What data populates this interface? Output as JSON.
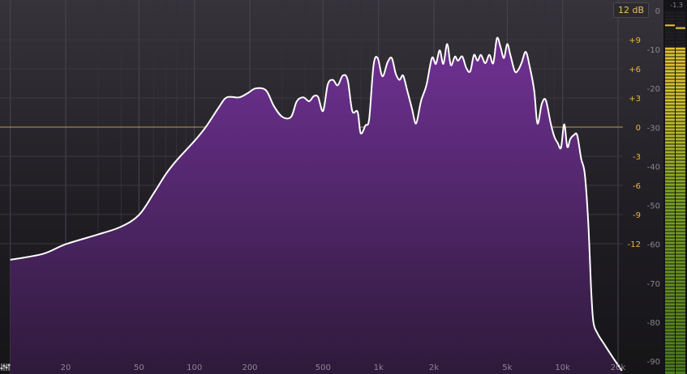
{
  "range_button": {
    "label": "12 dB"
  },
  "freq_labels": [
    "20",
    "50",
    "100",
    "200",
    "500",
    "1k",
    "2k",
    "5k",
    "10k",
    "20k"
  ],
  "freq_values": [
    20,
    50,
    100,
    200,
    500,
    1000,
    2000,
    5000,
    10000,
    20000
  ],
  "eq_scale": {
    "labels": [
      "+9",
      "+6",
      "+3",
      "0",
      "-3",
      "-6",
      "-9",
      "-12"
    ],
    "values": [
      9,
      6,
      3,
      0,
      -3,
      -6,
      -9,
      -12
    ],
    "color": "#e8b93a"
  },
  "db_scale": {
    "labels": [
      "0",
      "-10",
      "-20",
      "-30",
      "-40",
      "-50",
      "-60",
      "-70",
      "-80",
      "-90"
    ],
    "values": [
      0,
      -10,
      -20,
      -30,
      -40,
      -50,
      -60,
      -70,
      -80,
      -90
    ],
    "color": "#8a8690"
  },
  "meter": {
    "peak_label": "-1.3",
    "left_level_db": -9.5,
    "right_level_db": -9.5,
    "left_peak_db": -3.6,
    "right_peak_db": -4.3
  },
  "colors": {
    "spectrum_fill_top": "#6a2f8c",
    "spectrum_fill_bottom": "#2e1a3a",
    "spectrum_line": "#ffffff",
    "zero_line": "#b89a5a",
    "grid": "#3a3640"
  },
  "spectrum": [
    [
      10,
      -64
    ],
    [
      15,
      -62.5
    ],
    [
      20,
      -60
    ],
    [
      30,
      -57.5
    ],
    [
      40,
      -55.5
    ],
    [
      50,
      -52.5
    ],
    [
      60,
      -47
    ],
    [
      70,
      -42
    ],
    [
      80,
      -38.5
    ],
    [
      100,
      -33.5
    ],
    [
      115,
      -30
    ],
    [
      135,
      -25
    ],
    [
      150,
      -22.3
    ],
    [
      175,
      -22.3
    ],
    [
      195,
      -21.2
    ],
    [
      215,
      -20
    ],
    [
      245,
      -20.5
    ],
    [
      270,
      -24.5
    ],
    [
      300,
      -27.3
    ],
    [
      335,
      -27.3
    ],
    [
      360,
      -23.3
    ],
    [
      390,
      -22.3
    ],
    [
      420,
      -23.3
    ],
    [
      445,
      -22
    ],
    [
      470,
      -22.2
    ],
    [
      500,
      -25.8
    ],
    [
      530,
      -19
    ],
    [
      565,
      -17.8
    ],
    [
      600,
      -19.2
    ],
    [
      640,
      -16.7
    ],
    [
      680,
      -17.8
    ],
    [
      720,
      -25.8
    ],
    [
      770,
      -26
    ],
    [
      800,
      -31.5
    ],
    [
      850,
      -29.5
    ],
    [
      890,
      -27.8
    ],
    [
      940,
      -14
    ],
    [
      990,
      -12.2
    ],
    [
      1050,
      -16.9
    ],
    [
      1120,
      -13.3
    ],
    [
      1180,
      -12.2
    ],
    [
      1240,
      -16.2
    ],
    [
      1300,
      -17.8
    ],
    [
      1360,
      -16.7
    ],
    [
      1430,
      -20.4
    ],
    [
      1520,
      -25.2
    ],
    [
      1600,
      -29
    ],
    [
      1700,
      -23.3
    ],
    [
      1820,
      -19.2
    ],
    [
      1950,
      -12.2
    ],
    [
      2050,
      -13.7
    ],
    [
      2150,
      -10.2
    ],
    [
      2250,
      -13.7
    ],
    [
      2360,
      -8.6
    ],
    [
      2470,
      -14
    ],
    [
      2600,
      -11.8
    ],
    [
      2700,
      -12.9
    ],
    [
      2850,
      -11.8
    ],
    [
      3000,
      -14.8
    ],
    [
      3150,
      -15.6
    ],
    [
      3300,
      -11.4
    ],
    [
      3450,
      -12.9
    ],
    [
      3600,
      -11.4
    ],
    [
      3800,
      -13.5
    ],
    [
      4000,
      -11.4
    ],
    [
      4200,
      -13.5
    ],
    [
      4400,
      -7.1
    ],
    [
      4600,
      -9.4
    ],
    [
      4800,
      -12.2
    ],
    [
      5000,
      -8.6
    ],
    [
      5200,
      -11.4
    ],
    [
      5500,
      -15.6
    ],
    [
      5750,
      -15.2
    ],
    [
      6000,
      -13.3
    ],
    [
      6300,
      -10.6
    ],
    [
      6600,
      -14
    ],
    [
      7000,
      -20.4
    ],
    [
      7300,
      -29
    ],
    [
      7700,
      -24
    ],
    [
      8100,
      -23
    ],
    [
      8600,
      -28.8
    ],
    [
      9000,
      -32.3
    ],
    [
      9400,
      -34
    ],
    [
      9800,
      -35.2
    ],
    [
      10200,
      -29.2
    ],
    [
      10600,
      -35
    ],
    [
      11000,
      -33
    ],
    [
      11500,
      -32
    ],
    [
      12000,
      -32
    ],
    [
      12600,
      -38
    ],
    [
      13200,
      -42
    ],
    [
      13800,
      -55
    ],
    [
      14300,
      -72
    ],
    [
      14700,
      -80
    ],
    [
      15500,
      -83
    ],
    [
      17000,
      -86
    ],
    [
      19000,
      -89.5
    ],
    [
      21000,
      -92.5
    ]
  ]
}
